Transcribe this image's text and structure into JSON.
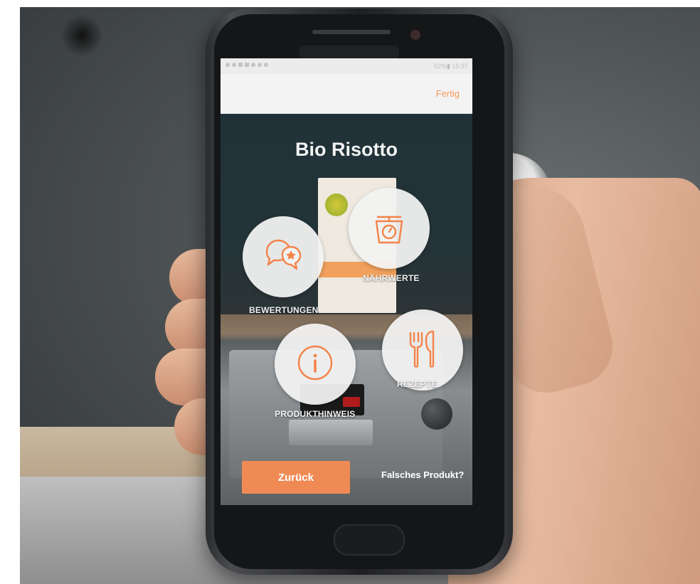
{
  "statusbar": {
    "right": "52%▮ 15:37"
  },
  "appbar": {
    "done_label": "Fertig"
  },
  "product": {
    "title": "Bio Risotto"
  },
  "menu": {
    "ratings": {
      "label": "BEWERTUNGEN",
      "icon": "chat-star-icon"
    },
    "nutrition": {
      "label": "NÄHRWERTE",
      "icon": "scale-icon"
    },
    "product_info": {
      "label": "PRODUKTHINWEIS",
      "icon": "info-icon"
    },
    "recipes": {
      "label": "REZEPTE",
      "icon": "fork-knife-icon"
    }
  },
  "footer": {
    "back_label": "Zurück",
    "wrong_product_label": "Falsches Produkt?"
  },
  "colors": {
    "accent": "#f08a55",
    "icon_stroke": "#f4834a",
    "circle_bg": "#f2f2f2"
  }
}
